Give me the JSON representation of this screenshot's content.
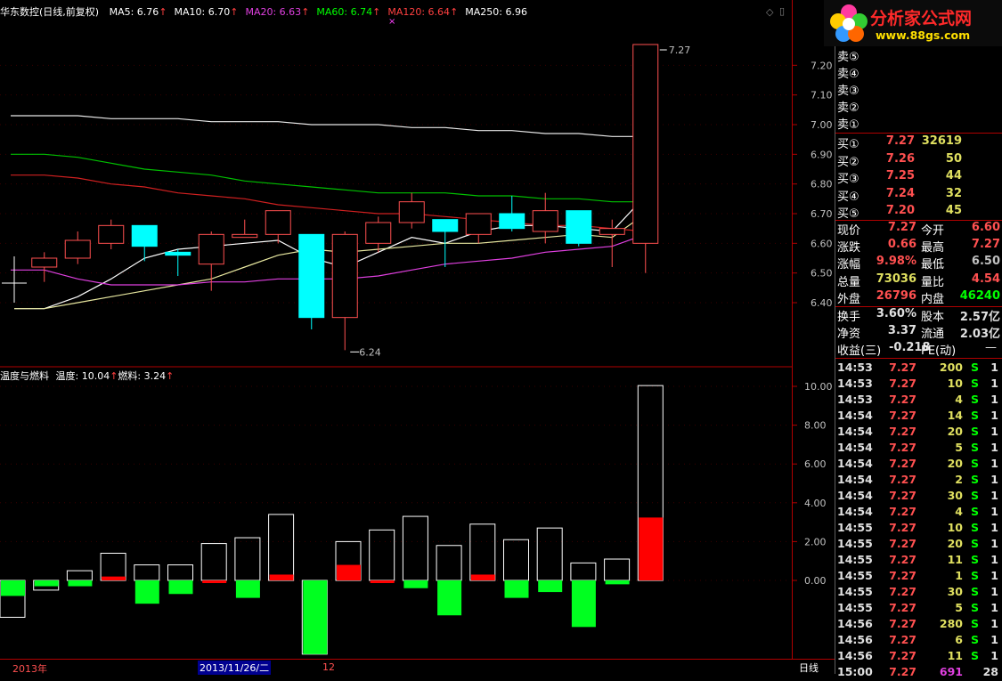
{
  "main_legend": {
    "title": "华东数控(日线,前复权)",
    "items": [
      {
        "label": "MA5: 6.76",
        "color": "#ffffff",
        "arrow": true
      },
      {
        "label": "MA10: 6.70",
        "color": "#ffffff",
        "arrow": true
      },
      {
        "label": "MA20: 6.63",
        "color": "#e040e0",
        "arrow": true
      },
      {
        "label": "MA60: 6.74",
        "color": "#00ff00",
        "arrow": true
      },
      {
        "label": "MA120: 6.64",
        "color": "#ff4040",
        "arrow": true
      },
      {
        "label": "MA250: 6.96",
        "color": "#ffffff",
        "arrow": false
      }
    ]
  },
  "sub_legend": {
    "title": "温度与燃料",
    "items": [
      {
        "label": "温度: 10.04",
        "color": "#ffffff",
        "arrow": true
      },
      {
        "label": "燃料: 3.24",
        "color": "#ffffff",
        "arrow": true
      }
    ]
  },
  "annotations": {
    "high": "7.27",
    "low": "6.24"
  },
  "bottom_bar": {
    "year": "2013年",
    "date": "2013/11/26/二",
    "month": "12",
    "period": "日线"
  },
  "logo": {
    "text": "分析家公式网",
    "url": "www.88gs.com"
  },
  "quote": {
    "sell": [
      {
        "label": "卖⑤",
        "price": "",
        "vol": ""
      },
      {
        "label": "卖④",
        "price": "",
        "vol": ""
      },
      {
        "label": "卖③",
        "price": "",
        "vol": ""
      },
      {
        "label": "卖②",
        "price": "",
        "vol": ""
      },
      {
        "label": "卖①",
        "price": "",
        "vol": ""
      }
    ],
    "buy": [
      {
        "label": "买①",
        "price": "7.27",
        "vol": "32619"
      },
      {
        "label": "买②",
        "price": "7.26",
        "vol": "50"
      },
      {
        "label": "买③",
        "price": "7.25",
        "vol": "44"
      },
      {
        "label": "买④",
        "price": "7.24",
        "vol": "32"
      },
      {
        "label": "买⑤",
        "price": "7.20",
        "vol": "45"
      }
    ],
    "stats": [
      {
        "l1": "现价",
        "v1": "7.27",
        "c1": "#ff5050",
        "l2": "今开",
        "v2": "6.60",
        "c2": "#ff5050"
      },
      {
        "l1": "涨跌",
        "v1": "0.66",
        "c1": "#ff5050",
        "l2": "最高",
        "v2": "7.27",
        "c2": "#ff5050"
      },
      {
        "l1": "涨幅",
        "v1": "9.98%",
        "c1": "#ff5050",
        "l2": "最低",
        "v2": "6.50",
        "c2": "#c0c0c0"
      },
      {
        "l1": "总量",
        "v1": "73036",
        "c1": "#e0e060",
        "l2": "量比",
        "v2": "4.54",
        "c2": "#ff5050"
      },
      {
        "l1": "外盘",
        "v1": "26796",
        "c1": "#ff5050",
        "l2": "内盘",
        "v2": "46240",
        "c2": "#00ff00"
      }
    ],
    "stats2": [
      {
        "l1": "换手",
        "v1": "3.60%",
        "l2": "股本",
        "v2": "2.57亿"
      },
      {
        "l1": "净资",
        "v1": "3.37",
        "l2": "流通",
        "v2": "2.03亿"
      }
    ],
    "eps": {
      "label": "收益(三)",
      "value": "-0.218",
      "pe_label": "PE(动)",
      "pe_value": "—"
    }
  },
  "trades": [
    {
      "time": "14:53",
      "price": "7.27",
      "vol": "200",
      "bs": "S",
      "n": "1"
    },
    {
      "time": "14:53",
      "price": "7.27",
      "vol": "10",
      "bs": "S",
      "n": "1"
    },
    {
      "time": "14:53",
      "price": "7.27",
      "vol": "4",
      "bs": "S",
      "n": "1"
    },
    {
      "time": "14:54",
      "price": "7.27",
      "vol": "14",
      "bs": "S",
      "n": "1"
    },
    {
      "time": "14:54",
      "price": "7.27",
      "vol": "20",
      "bs": "S",
      "n": "1"
    },
    {
      "time": "14:54",
      "price": "7.27",
      "vol": "5",
      "bs": "S",
      "n": "1"
    },
    {
      "time": "14:54",
      "price": "7.27",
      "vol": "20",
      "bs": "S",
      "n": "1"
    },
    {
      "time": "14:54",
      "price": "7.27",
      "vol": "2",
      "bs": "S",
      "n": "1"
    },
    {
      "time": "14:54",
      "price": "7.27",
      "vol": "30",
      "bs": "S",
      "n": "1"
    },
    {
      "time": "14:54",
      "price": "7.27",
      "vol": "4",
      "bs": "S",
      "n": "1"
    },
    {
      "time": "14:55",
      "price": "7.27",
      "vol": "10",
      "bs": "S",
      "n": "1"
    },
    {
      "time": "14:55",
      "price": "7.27",
      "vol": "20",
      "bs": "S",
      "n": "1"
    },
    {
      "time": "14:55",
      "price": "7.27",
      "vol": "11",
      "bs": "S",
      "n": "1"
    },
    {
      "time": "14:55",
      "price": "7.27",
      "vol": "1",
      "bs": "S",
      "n": "1"
    },
    {
      "time": "14:55",
      "price": "7.27",
      "vol": "30",
      "bs": "S",
      "n": "1"
    },
    {
      "time": "14:55",
      "price": "7.27",
      "vol": "5",
      "bs": "S",
      "n": "1"
    },
    {
      "time": "14:56",
      "price": "7.27",
      "vol": "280",
      "bs": "S",
      "n": "1"
    },
    {
      "time": "14:56",
      "price": "7.27",
      "vol": "6",
      "bs": "S",
      "n": "1"
    },
    {
      "time": "14:56",
      "price": "7.27",
      "vol": "11",
      "bs": "S",
      "n": "1"
    },
    {
      "time": "15:00",
      "price": "7.27",
      "vol": "691",
      "bs": "",
      "n": "28"
    }
  ],
  "chart_data": [
    {
      "type": "candlestick",
      "y_ticks": [
        "7.20",
        "7.10",
        "7.00",
        "6.90",
        "6.80",
        "6.70",
        "6.60",
        "6.50",
        "6.40"
      ],
      "ylim": [
        6.22,
        7.3
      ],
      "candles": [
        {
          "o": 6.52,
          "c": 6.55,
          "h": 6.57,
          "l": 6.47
        },
        {
          "o": 6.55,
          "c": 6.61,
          "h": 6.64,
          "l": 6.53
        },
        {
          "o": 6.6,
          "c": 6.66,
          "h": 6.68,
          "l": 6.58
        },
        {
          "o": 6.66,
          "c": 6.59,
          "h": 6.66,
          "l": 6.54
        },
        {
          "o": 6.57,
          "c": 6.56,
          "h": 6.58,
          "l": 6.49
        },
        {
          "o": 6.53,
          "c": 6.63,
          "h": 6.64,
          "l": 6.44
        },
        {
          "o": 6.62,
          "c": 6.63,
          "h": 6.68,
          "l": 6.62
        },
        {
          "o": 6.63,
          "c": 6.71,
          "h": 6.71,
          "l": 6.6
        },
        {
          "o": 6.63,
          "c": 6.35,
          "h": 6.63,
          "l": 6.31
        },
        {
          "o": 6.35,
          "c": 6.63,
          "h": 6.64,
          "l": 6.24
        },
        {
          "o": 6.6,
          "c": 6.67,
          "h": 6.69,
          "l": 6.57
        },
        {
          "o": 6.67,
          "c": 6.74,
          "h": 6.77,
          "l": 6.65
        },
        {
          "o": 6.68,
          "c": 6.64,
          "h": 6.68,
          "l": 6.52
        },
        {
          "o": 6.63,
          "c": 6.7,
          "h": 6.7,
          "l": 6.6
        },
        {
          "o": 6.7,
          "c": 6.65,
          "h": 6.76,
          "l": 6.64
        },
        {
          "o": 6.64,
          "c": 6.71,
          "h": 6.77,
          "l": 6.6
        },
        {
          "o": 6.71,
          "c": 6.6,
          "h": 6.71,
          "l": 6.59
        },
        {
          "o": 6.63,
          "c": 6.65,
          "h": 6.68,
          "l": 6.52
        },
        {
          "o": 6.6,
          "c": 7.27,
          "h": 7.27,
          "l": 6.5
        }
      ],
      "ma": {
        "MA5": [
          6.38,
          6.42,
          6.48,
          6.55,
          6.58,
          6.59,
          6.6,
          6.61,
          6.55,
          6.52,
          6.57,
          6.62,
          6.6,
          6.64,
          6.66,
          6.66,
          6.65,
          6.64,
          6.76
        ],
        "MA10": [
          6.38,
          6.4,
          6.42,
          6.44,
          6.46,
          6.48,
          6.52,
          6.56,
          6.58,
          6.57,
          6.58,
          6.59,
          6.6,
          6.6,
          6.61,
          6.62,
          6.63,
          6.62,
          6.7
        ],
        "MA20": [
          6.51,
          6.48,
          6.46,
          6.46,
          6.46,
          6.47,
          6.47,
          6.48,
          6.48,
          6.48,
          6.49,
          6.51,
          6.53,
          6.54,
          6.55,
          6.57,
          6.58,
          6.59,
          6.63
        ],
        "MA60": [
          6.9,
          6.89,
          6.87,
          6.85,
          6.84,
          6.83,
          6.81,
          6.8,
          6.79,
          6.78,
          6.77,
          6.77,
          6.77,
          6.76,
          6.76,
          6.75,
          6.75,
          6.74,
          6.74
        ],
        "MA120": [
          6.83,
          6.82,
          6.8,
          6.79,
          6.77,
          6.76,
          6.75,
          6.73,
          6.72,
          6.71,
          6.7,
          6.7,
          6.69,
          6.68,
          6.67,
          6.66,
          6.66,
          6.65,
          6.64
        ],
        "MA250": [
          7.03,
          7.03,
          7.02,
          7.02,
          7.02,
          7.01,
          7.01,
          7.01,
          7.0,
          7.0,
          7.0,
          6.99,
          6.99,
          6.98,
          6.98,
          6.97,
          6.97,
          6.96,
          6.96
        ]
      }
    },
    {
      "type": "bar",
      "title": "温度与燃料",
      "y_ticks": [
        "10.00",
        "8.00",
        "6.00",
        "4.00",
        "2.00",
        "0.00"
      ],
      "ylim": [
        -4.0,
        10.0
      ],
      "series": [
        {
          "name": "温度",
          "values": [
            -1.9,
            -0.5,
            0.5,
            1.4,
            0.8,
            0.8,
            1.9,
            2.2,
            3.4,
            -3.8,
            2.0,
            2.6,
            3.3,
            1.8,
            2.9,
            2.1,
            2.7,
            0.9,
            1.1,
            10.04
          ]
        },
        {
          "name": "燃料",
          "values": [
            -0.8,
            -0.3,
            -0.3,
            0.2,
            -1.2,
            -0.7,
            0.0,
            -0.9,
            0.3,
            -3.8,
            0.8,
            0.0,
            -0.4,
            -1.8,
            0.3,
            -0.9,
            -0.6,
            -2.4,
            -0.2,
            3.24
          ]
        }
      ]
    }
  ]
}
